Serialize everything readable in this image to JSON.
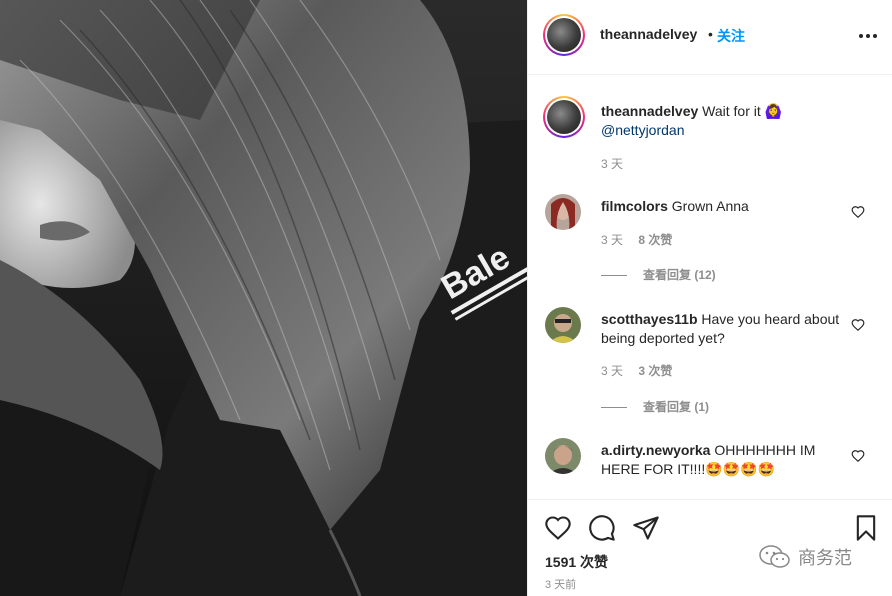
{
  "header": {
    "username": "theannadelvey",
    "dot": "•",
    "follow_label": "关注",
    "more_icon": "more-horizontal-icon"
  },
  "caption": {
    "username": "theannadelvey",
    "text": "Wait for it",
    "emoji": "🙆‍♀️",
    "mention": "@nettyjordan",
    "time": "3 天"
  },
  "comments": [
    {
      "username": "filmcolors",
      "text": "Grown Anna",
      "time": "3 天",
      "likes": "8 次赞",
      "replies": "查看回复 (12)"
    },
    {
      "username": "scotthayes11b",
      "text": "Have you heard about being deported yet?",
      "time": "3 天",
      "likes": "3 次赞",
      "replies": "查看回复 (1)"
    },
    {
      "username": "a.dirty.newyorka",
      "text": "OHHHHHHH IM HERE FOR IT!!!!🤩🤩🤩🤩"
    }
  ],
  "actions": {
    "like_icon": "heart-icon",
    "comment_icon": "comment-bubble-icon",
    "share_icon": "paper-plane-icon",
    "save_icon": "bookmark-icon",
    "likes_count": "1591 次赞",
    "post_time": "3 天前"
  },
  "watermark": {
    "text": "商务范"
  },
  "photo": {
    "text_on_sweatshirt": "Bale"
  }
}
